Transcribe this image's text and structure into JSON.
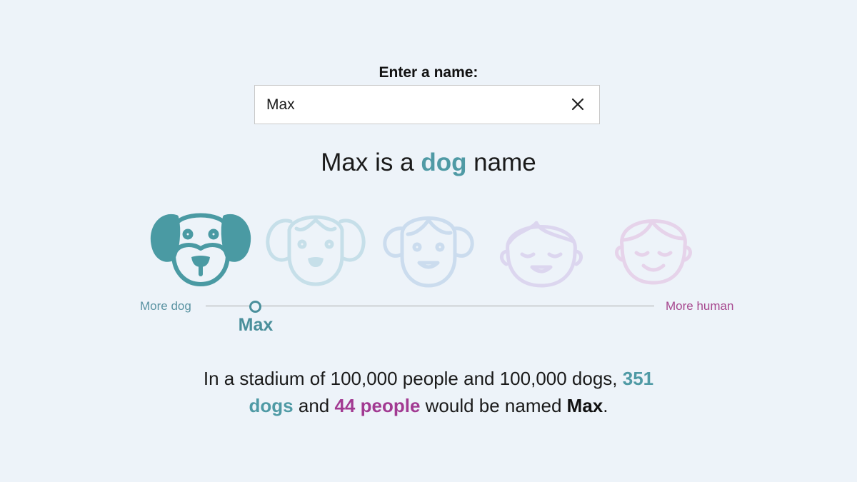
{
  "prompt_label": "Enter a name:",
  "input": {
    "value": "Max",
    "clear_icon": "close-icon"
  },
  "headline": {
    "name": "Max",
    "pre": " is a ",
    "category": "dog",
    "post": " name"
  },
  "icons": [
    {
      "name": "dog-face-icon",
      "color": "#4a9aa3",
      "active": true
    },
    {
      "name": "dog-human-face-icon",
      "color": "#c6dfe9",
      "active": false
    },
    {
      "name": "human-dog-face-icon",
      "color": "#cbdcee",
      "active": false
    },
    {
      "name": "human-face-icon",
      "color": "#dcd6ef",
      "active": false
    },
    {
      "name": "sleepy-human-face-icon",
      "color": "#e6d3ea",
      "active": false
    }
  ],
  "scale": {
    "left_label": "More dog",
    "right_label": "More human",
    "marker_label": "Max"
  },
  "stats": {
    "line1": "In a stadium of 100,000 people and 100,000 dogs, ",
    "dog_count": "351",
    "dog_word": "dogs",
    "and": " and ",
    "people": "44 people",
    "tail": " would be named ",
    "name": "Max",
    "period": "."
  },
  "colors": {
    "dog": "#4f9aa5",
    "human": "#a23a92",
    "background": "#edf3f9"
  }
}
